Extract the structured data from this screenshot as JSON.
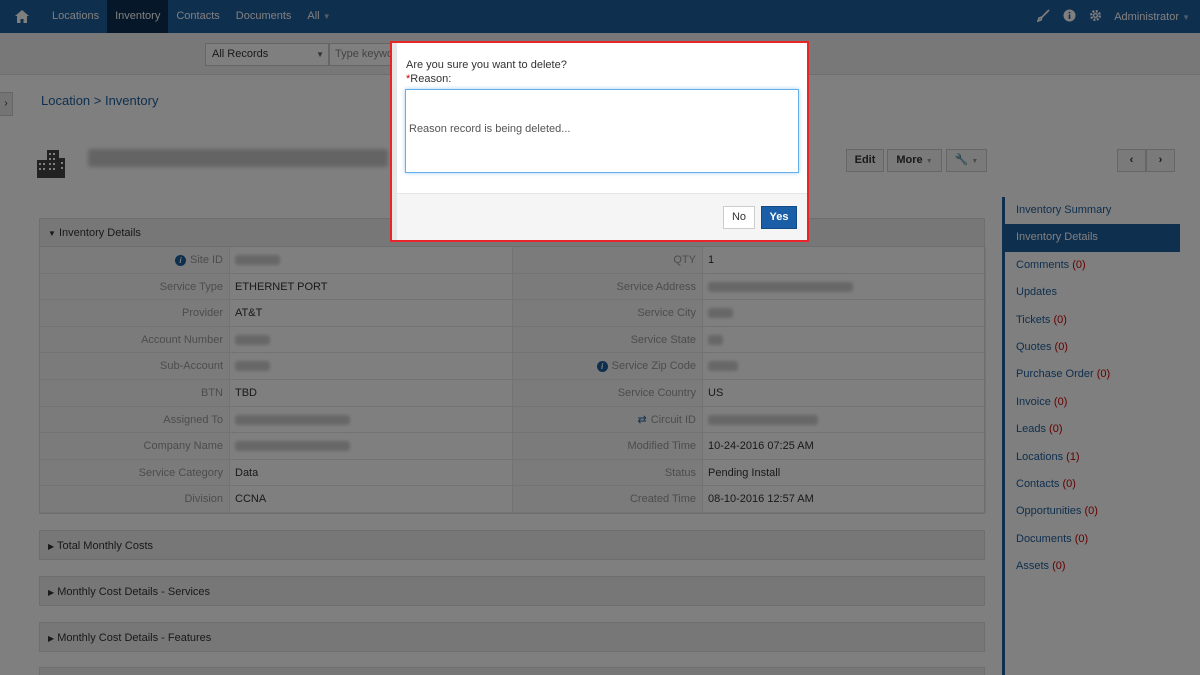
{
  "nav": {
    "items": [
      {
        "label": "Locations"
      },
      {
        "label": "Inventory",
        "active": true
      },
      {
        "label": "Contacts"
      },
      {
        "label": "Documents"
      },
      {
        "label": "All"
      }
    ],
    "user": "Administrator"
  },
  "search": {
    "filter": "All Records",
    "placeholder": "Type keywo"
  },
  "breadcrumb": "Location > Inventory",
  "toolbar": {
    "edit": "Edit",
    "more": "More"
  },
  "details": {
    "title": "Inventory Details",
    "left": [
      {
        "label": "Site ID",
        "value": ""
      },
      {
        "label": "Service Type",
        "value": "ETHERNET PORT"
      },
      {
        "label": "Provider",
        "value": "AT&T"
      },
      {
        "label": "Account Number",
        "value": ""
      },
      {
        "label": "Sub-Account",
        "value": ""
      },
      {
        "label": "BTN",
        "value": "TBD"
      },
      {
        "label": "Assigned To",
        "value": ""
      },
      {
        "label": "Company Name",
        "value": ""
      },
      {
        "label": "Service Category",
        "value": "Data"
      },
      {
        "label": "Division",
        "value": "CCNA"
      }
    ],
    "right": [
      {
        "label": "QTY",
        "value": "1"
      },
      {
        "label": "Service Address",
        "value": ""
      },
      {
        "label": "Service City",
        "value": ""
      },
      {
        "label": "Service State",
        "value": ""
      },
      {
        "label": "Service Zip Code",
        "value": ""
      },
      {
        "label": "Service Country",
        "value": "US"
      },
      {
        "label": "Circuit ID",
        "value": ""
      },
      {
        "label": "Modified Time",
        "value": "10-24-2016 07:25 AM"
      },
      {
        "label": "Status",
        "value": "Pending Install"
      },
      {
        "label": "Created Time",
        "value": "08-10-2016 12:57 AM"
      }
    ]
  },
  "sections": [
    {
      "label": "Total Monthly Costs"
    },
    {
      "label": "Monthly Cost Details - Services"
    },
    {
      "label": "Monthly Cost Details - Features"
    }
  ],
  "sidenav": [
    {
      "label": "Inventory Summary",
      "count": ""
    },
    {
      "label": "Inventory Details",
      "count": ""
    },
    {
      "label": "Comments",
      "count": "(0)"
    },
    {
      "label": "Updates",
      "count": ""
    },
    {
      "label": "Tickets",
      "count": "(0)"
    },
    {
      "label": "Quotes",
      "count": "(0)"
    },
    {
      "label": "Purchase Order",
      "count": "(0)"
    },
    {
      "label": "Invoice",
      "count": "(0)"
    },
    {
      "label": "Leads",
      "count": "(0)"
    },
    {
      "label": "Locations",
      "count": "(1)"
    },
    {
      "label": "Contacts",
      "count": "(0)"
    },
    {
      "label": "Opportunities",
      "count": "(0)"
    },
    {
      "label": "Documents",
      "count": "(0)"
    },
    {
      "label": "Assets",
      "count": "(0)"
    }
  ],
  "dialog": {
    "question": "Are you sure you want to delete?",
    "reason_star": "*",
    "reason_label": "Reason:",
    "placeholder": "Reason record is being deleted...",
    "no": "No",
    "yes": "Yes"
  },
  "colors": {
    "brand": "#1f5e9c",
    "dialog_border": "#e8262a",
    "yes_button": "#1a5ea8"
  }
}
